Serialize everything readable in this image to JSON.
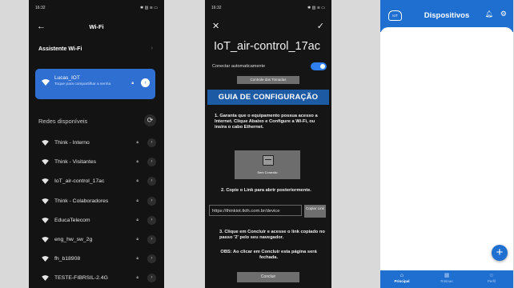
{
  "phone1": {
    "status_time": "16:32",
    "status_icons": "✱ ▥ ≋ ▭",
    "title": "Wi-Fi",
    "assistant_label": "Assistente Wi-Fi",
    "connected": {
      "name": "Lucas_IOT",
      "subtitle": "Toque para compartilhar a senha"
    },
    "available_label": "Redes disponíveis",
    "networks": [
      "Think - Interno",
      "Think - Visitantes",
      "IoT_air-control_17ac",
      "Think - Colaboradores",
      "EducaTelecom",
      "eng_hw_sw_2g",
      "fh_b18908",
      "TESTE-FIBRSIL-2.4G"
    ]
  },
  "phone2": {
    "status_time": "16:32",
    "status_icons": "✱ ▥ ≋ ▭",
    "network_title": "IoT_air-control_17ac",
    "auto_connect": "Conectar automaticamente",
    "controle_button": "Controle das Tomadas",
    "guide_title": "GUIA DE CONFIGURAÇÃO",
    "step1": "1. Garanta que o equipamento possua acesso a Internet. Clique Abaixo e Configure a Wi-Fi, ou insira o cabo Ethernet.",
    "sem_conexao": "Sem Conexão",
    "step2": "2. Copie o Link para abrir posteriormente.",
    "link_value": "https://thinkiot.tkth.com.br/device",
    "copy_label": "Copiar Link",
    "step3": "3. Clique em Concluir e acesse o link copiado no passo '2' pelo seu navegador.",
    "obs": "OBS: Ao clicar em Concluir esta página será fechada.",
    "concluir": "Concluir"
  },
  "phone3": {
    "logo_text": "IoT",
    "title": "Dispositivos",
    "fab": "+",
    "nav": [
      {
        "label": "Principal",
        "icon": "home-icon"
      },
      {
        "label": "Rotinas",
        "icon": "calendar-icon"
      },
      {
        "label": "Perfil",
        "icon": "profile-icon"
      }
    ]
  },
  "colors": {
    "accent": "#1e6fd0",
    "wifi_card": "#2f6fd1",
    "dark_bg": "#131313",
    "guide_bar": "#1d5aa4"
  }
}
